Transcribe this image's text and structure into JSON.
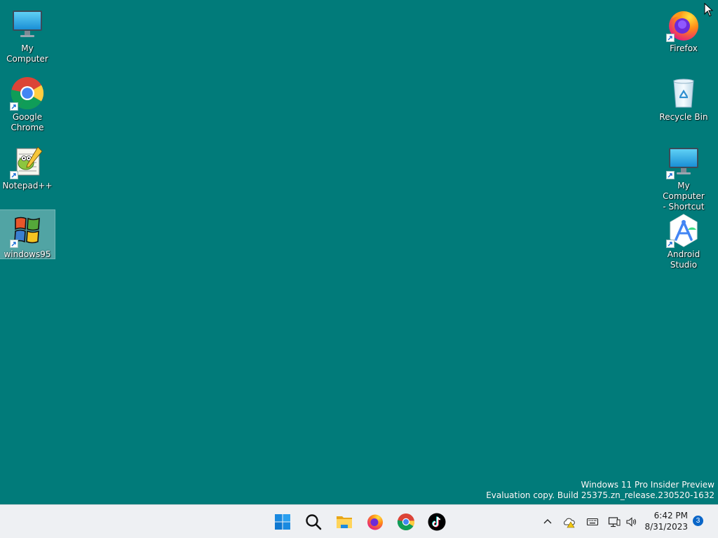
{
  "desktop": {
    "background": "#017b7a",
    "icons": [
      {
        "id": "my-computer",
        "label": "My Computer",
        "icon": "monitor-icon",
        "shortcut": false,
        "selected": false
      },
      {
        "id": "google-chrome",
        "label": "Google\nChrome",
        "icon": "chrome-icon",
        "shortcut": true,
        "selected": false
      },
      {
        "id": "notepad-plus-plus",
        "label": "Notepad++",
        "icon": "notepadpp-icon",
        "shortcut": true,
        "selected": false
      },
      {
        "id": "windows95",
        "label": "windows95",
        "icon": "windows95-icon",
        "shortcut": true,
        "selected": true
      },
      {
        "id": "firefox",
        "label": "Firefox",
        "icon": "firefox-icon",
        "shortcut": true,
        "selected": false
      },
      {
        "id": "recycle-bin",
        "label": "Recycle Bin",
        "icon": "recycle-bin-icon",
        "shortcut": false,
        "selected": false
      },
      {
        "id": "my-computer-shortcut",
        "label": "My Computer\n- Shortcut",
        "icon": "monitor-icon",
        "shortcut": true,
        "selected": false
      },
      {
        "id": "android-studio",
        "label": "Android\nStudio",
        "icon": "android-studio-icon",
        "shortcut": true,
        "selected": false
      }
    ]
  },
  "watermark": {
    "line1": "Windows 11 Pro Insider Preview",
    "line2": "Evaluation copy. Build 25375.zn_release.230520-1632"
  },
  "taskbar": {
    "background": "#eef0f3",
    "pinned": [
      {
        "id": "start",
        "icon": "windows-start-icon"
      },
      {
        "id": "search",
        "icon": "search-icon"
      },
      {
        "id": "file-explorer",
        "icon": "file-explorer-icon"
      },
      {
        "id": "firefox",
        "icon": "firefox-icon"
      },
      {
        "id": "chrome",
        "icon": "chrome-icon"
      },
      {
        "id": "tiktok",
        "icon": "tiktok-icon"
      }
    ],
    "tray": [
      {
        "id": "show-hidden",
        "icon": "chevron-up-icon"
      },
      {
        "id": "onedrive",
        "icon": "onedrive-warning-icon"
      },
      {
        "id": "keyboard",
        "icon": "keyboard-icon"
      },
      {
        "id": "network",
        "icon": "network-icon"
      },
      {
        "id": "volume",
        "icon": "volume-icon"
      }
    ],
    "clock": {
      "time": "6:42 PM",
      "date": "8/31/2023"
    },
    "notification_count": "3"
  }
}
